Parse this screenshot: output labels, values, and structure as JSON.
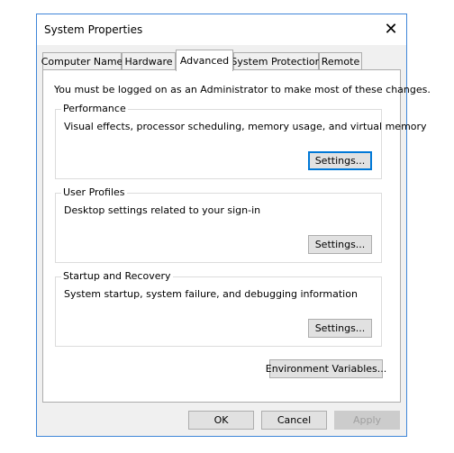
{
  "window": {
    "title": "System Properties",
    "close_glyph": "✕"
  },
  "tabs": [
    {
      "label": "Computer Name"
    },
    {
      "label": "Hardware"
    },
    {
      "label": "Advanced",
      "active": true
    },
    {
      "label": "System Protection"
    },
    {
      "label": "Remote"
    }
  ],
  "panel": {
    "notice": "You must be logged on as an Administrator to make most of these changes.",
    "groups": [
      {
        "legend": "Performance",
        "description": "Visual effects, processor scheduling, memory usage, and virtual memory",
        "button": "Settings..."
      },
      {
        "legend": "User Profiles",
        "description": "Desktop settings related to your sign-in",
        "button": "Settings..."
      },
      {
        "legend": "Startup and Recovery",
        "description": "System startup, system failure, and debugging information",
        "button": "Settings..."
      }
    ],
    "env_button": "Environment Variables..."
  },
  "footer": {
    "ok": "OK",
    "cancel": "Cancel",
    "apply": "Apply"
  },
  "colors": {
    "window_border": "#3f86d8",
    "focus_border": "#0078d7",
    "dialog_bg": "#f0f0f0"
  }
}
